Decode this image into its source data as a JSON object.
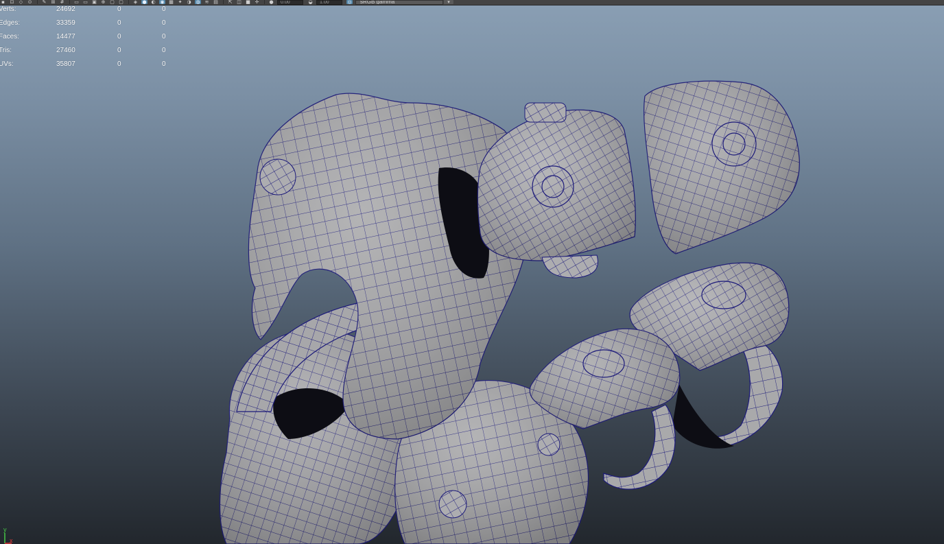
{
  "toolbar": {
    "field1": "0.00",
    "field2": "1.00",
    "color_space": "sRGB gamma"
  },
  "hud": {
    "rows": [
      {
        "label": "Verts:",
        "c1": "24692",
        "c2": "0",
        "c3": "0"
      },
      {
        "label": "Edges:",
        "c1": "33359",
        "c2": "0",
        "c3": "0"
      },
      {
        "label": "Faces:",
        "c1": "14477",
        "c2": "0",
        "c3": "0"
      },
      {
        "label": "Tris:",
        "c1": "27460",
        "c2": "0",
        "c3": "0"
      },
      {
        "label": "UVs:",
        "c1": "35807",
        "c2": "0",
        "c3": "0"
      }
    ]
  },
  "axis": {
    "y_label": "y",
    "x_label": "x",
    "y_color": "#46c846",
    "x_color": "#e03a3a"
  },
  "colors": {
    "mesh_fill": "#a9a9ab",
    "wireframe": "#1c1a7a",
    "cavity": "#0d0d14",
    "active_button": "#5285a6"
  }
}
